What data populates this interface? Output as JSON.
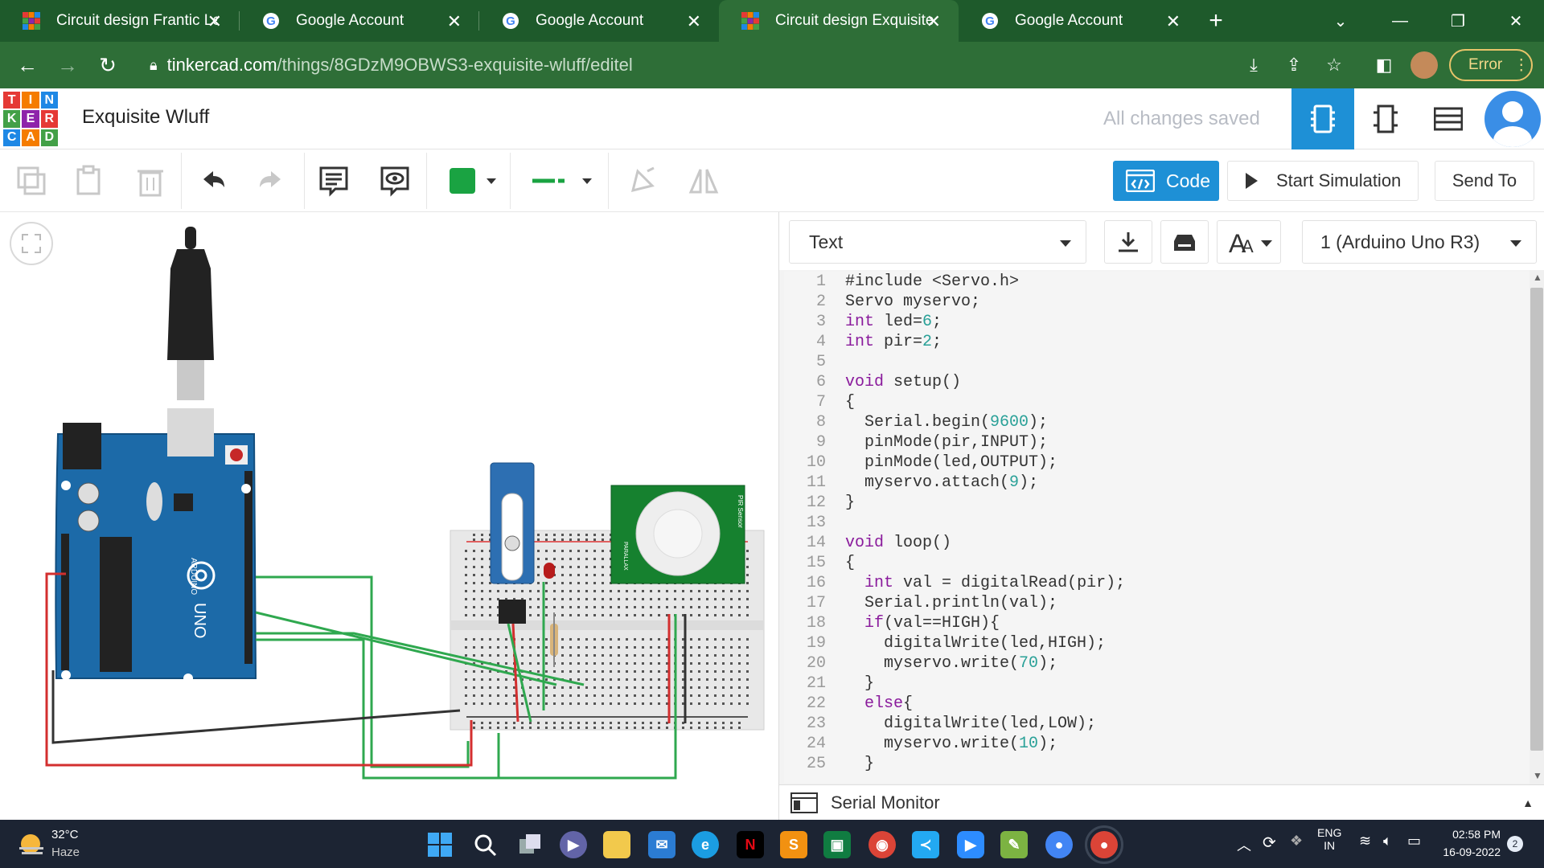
{
  "browser": {
    "tabs": [
      {
        "title": "Circuit design Frantic Le",
        "favicon": "tinkercad",
        "active": false
      },
      {
        "title": "Google Account",
        "favicon": "google",
        "active": false
      },
      {
        "title": "Google Account",
        "favicon": "google",
        "active": false
      },
      {
        "title": "Circuit design Exquisite",
        "favicon": "tinkercad",
        "active": true
      },
      {
        "title": "Google Account",
        "favicon": "google",
        "active": false
      }
    ],
    "url_host": "tinkercad.com",
    "url_path": "/things/8GDzM9OBWS3-exquisite-wluff/editel",
    "error_label": "Error"
  },
  "app": {
    "logo_letters": [
      "T",
      "I",
      "N",
      "K",
      "E",
      "R",
      "C",
      "A",
      "D"
    ],
    "project_name": "Exquisite Wluff",
    "save_status": "All changes saved"
  },
  "toolbar": {
    "code_label": "Code",
    "start_sim_label": "Start Simulation",
    "send_to_label": "Send To",
    "fill_color": "#1aa342",
    "wire_color": "#1aa342"
  },
  "code_panel": {
    "mode": "Text",
    "device": "1 (Arduino Uno R3)",
    "serial_monitor_label": "Serial Monitor",
    "lines": [
      {
        "n": "1",
        "t": "#include <Servo.h>"
      },
      {
        "n": "2",
        "t": "Servo myservo;"
      },
      {
        "n": "3",
        "t": "int led=6;"
      },
      {
        "n": "4",
        "t": "int pir=2;"
      },
      {
        "n": "5",
        "t": ""
      },
      {
        "n": "6",
        "t": "void setup()"
      },
      {
        "n": "7",
        "t": "{"
      },
      {
        "n": "8",
        "t": "  Serial.begin(9600);"
      },
      {
        "n": "9",
        "t": "  pinMode(pir,INPUT);"
      },
      {
        "n": "10",
        "t": "  pinMode(led,OUTPUT);"
      },
      {
        "n": "11",
        "t": "  myservo.attach(9);"
      },
      {
        "n": "12",
        "t": "}"
      },
      {
        "n": "13",
        "t": ""
      },
      {
        "n": "14",
        "t": "void loop()"
      },
      {
        "n": "15",
        "t": "{"
      },
      {
        "n": "16",
        "t": "  int val = digitalRead(pir);"
      },
      {
        "n": "17",
        "t": "  Serial.println(val);"
      },
      {
        "n": "18",
        "t": "  if(val==HIGH){"
      },
      {
        "n": "19",
        "t": "    digitalWrite(led,HIGH);"
      },
      {
        "n": "20",
        "t": "    myservo.write(70);"
      },
      {
        "n": "21",
        "t": "  }"
      },
      {
        "n": "22",
        "t": "  else{"
      },
      {
        "n": "23",
        "t": "    digitalWrite(led,LOW);"
      },
      {
        "n": "24",
        "t": "    myservo.write(10);"
      },
      {
        "n": "25",
        "t": "  }"
      }
    ]
  },
  "circuit": {
    "arduino_label": "ARDUINO",
    "arduino_model": "UNO",
    "pir_label": "PIR Sensor",
    "pir_brand": "PARALLAX"
  },
  "taskbar": {
    "weather_temp": "32°C",
    "weather_desc": "Haze",
    "lang_line1": "ENG",
    "lang_line2": "IN",
    "time": "02:58 PM",
    "date": "16-09-2022",
    "notification_count": "2"
  }
}
